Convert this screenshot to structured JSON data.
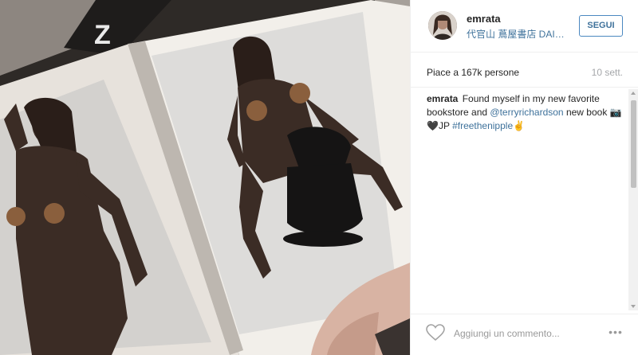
{
  "post": {
    "username": "emrata",
    "location": "代官山 蔦屋書店 DAIKANYAMA T-SITE",
    "follow_label": "SEGUI",
    "likes_text": "Piace a 167k persone",
    "time_text": "10 sett.",
    "caption": {
      "username": "emrata",
      "text_before": " Found myself in my new favorite bookstore and ",
      "mention": "@terryrichardson",
      "text_middle": " new book 📷🖤JP ",
      "hashtag": "#freethenipple",
      "text_after": "✌"
    },
    "comment_placeholder": "Aggiungi un commento...",
    "more_label": "•••"
  },
  "icons": {
    "like": "heart-outline-icon",
    "more": "more-dots-icon",
    "avatar": "profile-avatar"
  },
  "colors": {
    "link": "#3f729b",
    "follow_border": "#4b88c0",
    "text": "#262626",
    "muted": "#a5a7aa"
  }
}
